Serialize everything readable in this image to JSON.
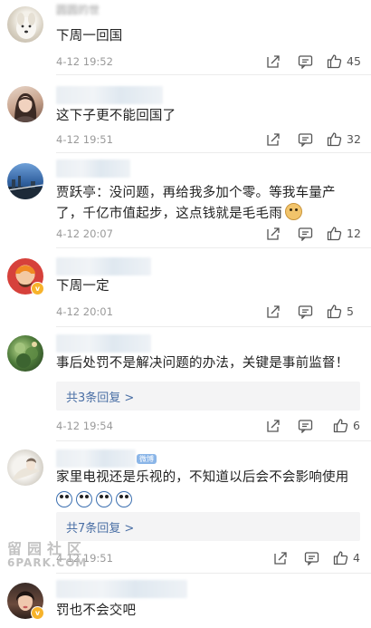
{
  "comments": [
    {
      "author": "圆圆的世",
      "text": "下周一回国",
      "time": "4-12 19:52",
      "likes": "45"
    },
    {
      "author": "",
      "text": "这下子更不能回国了",
      "time": "4-12 19:51",
      "likes": "32"
    },
    {
      "author": "",
      "text": "贾跃亭：没问题，再给我多加个零。等我车量产了，千亿市值起步，这点钱就是毛毛雨",
      "time": "4-12 20:07",
      "likes": "12",
      "emoji": "doge-emoji"
    },
    {
      "author": "",
      "text": "下周一定",
      "time": "4-12 20:01",
      "likes": "5"
    },
    {
      "author": "",
      "text": "事后处罚不是解决问题的办法，关键是事前监督！",
      "time": "4-12 19:54",
      "likes": "6",
      "replies": "共3条回复 >"
    },
    {
      "author": "",
      "text": "家里电视还是乐视的，不知道以后会不会影响使用",
      "time": "4-12 19:51",
      "likes": "4",
      "replies": "共7条回复 >",
      "emoji_row": [
        "cry-emoji",
        "cry-emoji",
        "cry-emoji",
        "cry-emoji"
      ],
      "name_tag": "微博"
    },
    {
      "author": "",
      "text": "罚也不会交吧",
      "time": "",
      "likes": ""
    }
  ],
  "watermark": {
    "cn": "留园社区",
    "en": "6PARK.COM"
  },
  "icons": {
    "share": "share-icon",
    "comment": "comment-icon",
    "like": "thumbs-up-icon"
  },
  "colors": {
    "reply_link": "#4a6fa5",
    "time_gray": "#9a9a9a",
    "badge": "#f7b32b"
  }
}
